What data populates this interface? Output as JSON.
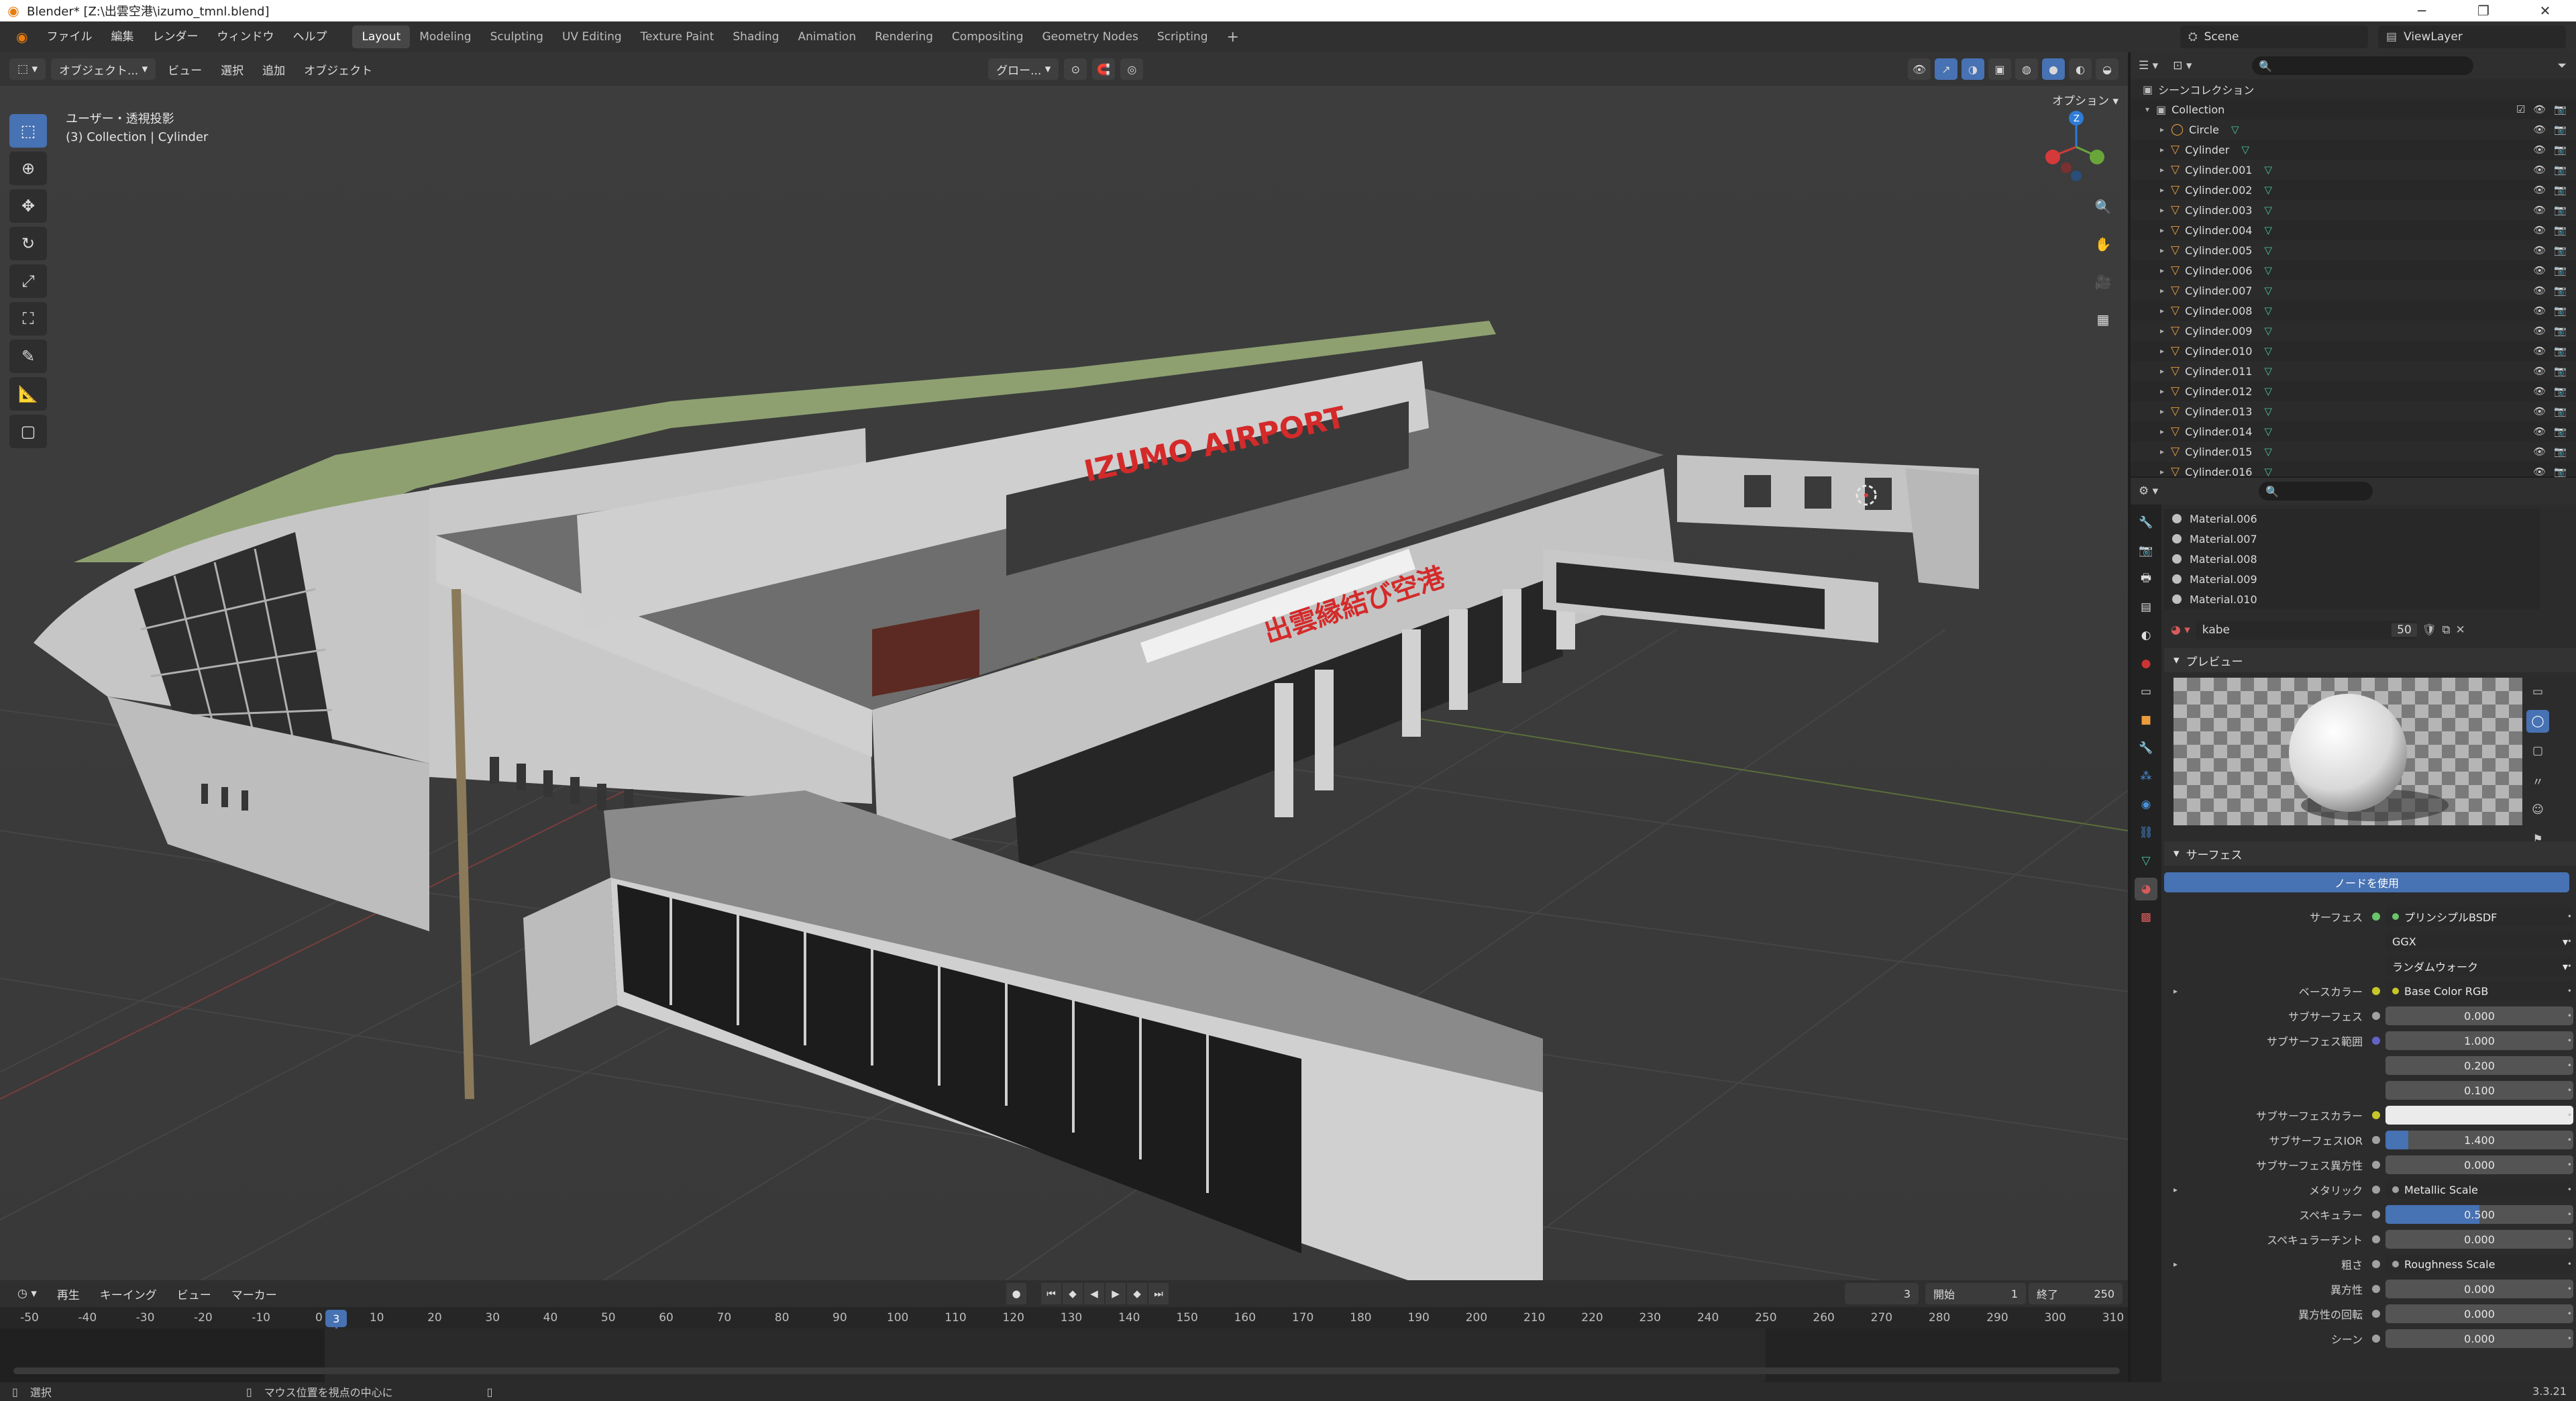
{
  "titlebar": {
    "title": "Blender* [Z:\\出雲空港\\izumo_tmnl.blend]"
  },
  "menu": [
    "ファイル",
    "編集",
    "レンダー",
    "ウィンドウ",
    "ヘルプ"
  ],
  "workspaces": [
    "Layout",
    "Modeling",
    "Sculpting",
    "UV Editing",
    "Texture Paint",
    "Shading",
    "Animation",
    "Rendering",
    "Compositing",
    "Geometry Nodes",
    "Scripting"
  ],
  "scene": {
    "label": "Scene"
  },
  "viewlayer": {
    "label": "ViewLayer"
  },
  "viewport": {
    "mode": "オブジェクト...",
    "menus": [
      "ビュー",
      "選択",
      "追加",
      "オブジェクト"
    ],
    "transform": "グロー...",
    "options": "オプション",
    "info_line1": "ユーザー・透視投影",
    "info_line2": "(3) Collection | Cylinder",
    "signage_en": "IZUMO AIRPORT",
    "signage_jp": "出雲縁結び空港"
  },
  "timeline": {
    "menus": [
      "再生",
      "キーイング",
      "ビュー",
      "マーカー"
    ],
    "current_frame": "3",
    "start_label": "開始",
    "start": "1",
    "end_label": "終了",
    "end": "250",
    "ticks": [
      "-50",
      "-40",
      "-30",
      "-20",
      "-10",
      "0",
      "10",
      "20",
      "30",
      "40",
      "50",
      "60",
      "70",
      "80",
      "90",
      "100",
      "110",
      "120",
      "130",
      "140",
      "150",
      "160",
      "170",
      "180",
      "190",
      "200",
      "210",
      "220",
      "230",
      "240",
      "250",
      "260",
      "270",
      "280",
      "290",
      "300",
      "310"
    ]
  },
  "statusbar": {
    "select": "選択",
    "hint": "マウス位置を視点の中心に",
    "version": "3.3.21"
  },
  "outliner": {
    "scene_collection": "シーンコレクション",
    "collection": "Collection",
    "items": [
      "Circle",
      "Cylinder",
      "Cylinder.001",
      "Cylinder.002",
      "Cylinder.003",
      "Cylinder.004",
      "Cylinder.005",
      "Cylinder.006",
      "Cylinder.007",
      "Cylinder.008",
      "Cylinder.009",
      "Cylinder.010",
      "Cylinder.011",
      "Cylinder.012",
      "Cylinder.013",
      "Cylinder.014",
      "Cylinder.015",
      "Cylinder.016"
    ]
  },
  "properties": {
    "material_slots": [
      "Material.006",
      "Material.007",
      "Material.008",
      "Material.009",
      "Material.010"
    ],
    "material_name": "kabe",
    "material_users": "50",
    "preview_label": "プレビュー",
    "surface_label": "サーフェス",
    "use_nodes": "ノードを使用",
    "rows": [
      {
        "label": "サーフェス",
        "value": "プリンシプルBSDF",
        "kind": "socket",
        "dot": "#6ac46a"
      },
      {
        "label": "",
        "value": "GGX",
        "kind": "menu"
      },
      {
        "label": "",
        "value": "ランダムウォーク",
        "kind": "menu"
      },
      {
        "label": "ベースカラー",
        "value": "Base Color RGB",
        "kind": "socket",
        "dot": "#c7c729",
        "expand": true
      },
      {
        "label": "サブサーフェス",
        "value": "0.000",
        "kind": "num",
        "dot": "#a1a1a1",
        "fill": 0
      },
      {
        "label": "サブサーフェス範囲",
        "value": "1.000",
        "kind": "num",
        "dot": "#6363c7",
        "fill": 0
      },
      {
        "label": "",
        "value": "0.200",
        "kind": "num",
        "fill": 0
      },
      {
        "label": "",
        "value": "0.100",
        "kind": "num",
        "fill": 0
      },
      {
        "label": "サブサーフェスカラー",
        "value": "",
        "kind": "color",
        "dot": "#c7c729",
        "color": "#ebebeb"
      },
      {
        "label": "サブサーフェスIOR",
        "value": "1.400",
        "kind": "num",
        "dot": "#a1a1a1",
        "fill": 0.12
      },
      {
        "label": "サブサーフェス異方性",
        "value": "0.000",
        "kind": "num",
        "dot": "#a1a1a1",
        "fill": 0
      },
      {
        "label": "メタリック",
        "value": "Metallic Scale",
        "kind": "socket",
        "dot": "#a1a1a1",
        "expand": true
      },
      {
        "label": "スペキュラー",
        "value": "0.500",
        "kind": "num",
        "dot": "#a1a1a1",
        "fill": 0.5
      },
      {
        "label": "スペキュラーチント",
        "value": "0.000",
        "kind": "num",
        "dot": "#a1a1a1",
        "fill": 0
      },
      {
        "label": "粗さ",
        "value": "Roughness Scale",
        "kind": "socket",
        "dot": "#a1a1a1",
        "expand": true
      },
      {
        "label": "異方性",
        "value": "0.000",
        "kind": "num",
        "dot": "#a1a1a1",
        "fill": 0
      },
      {
        "label": "異方性の回転",
        "value": "0.000",
        "kind": "num",
        "dot": "#a1a1a1",
        "fill": 0
      },
      {
        "label": "シーン",
        "value": "0.000",
        "kind": "num",
        "dot": "#a1a1a1",
        "fill": 0
      }
    ]
  },
  "colors": {
    "accent": "#4772b3",
    "header": "#303030",
    "viewport_bg": "#3c3c3c",
    "object_orange": "#e89c3c",
    "mesh_green": "#49c3a3"
  }
}
